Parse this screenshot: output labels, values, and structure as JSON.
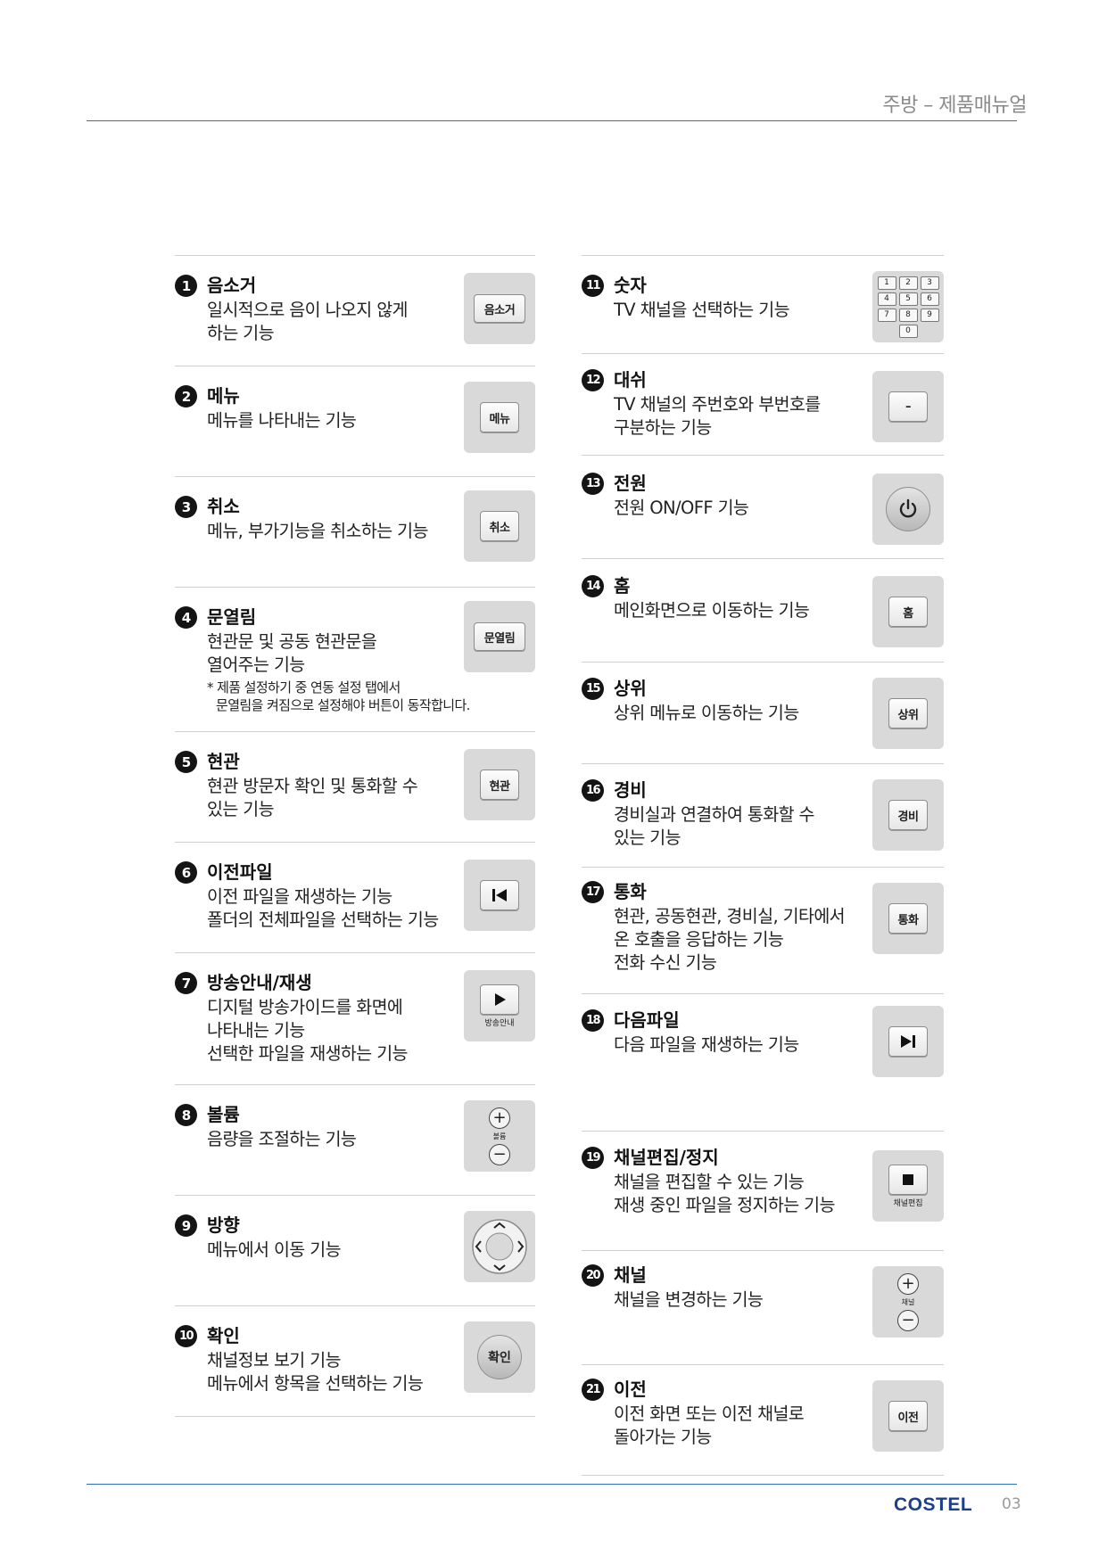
{
  "header": {
    "title": "주방 – 제품매뉴얼"
  },
  "footer": {
    "brand": "COSTEL",
    "page": "03"
  },
  "left_items": [
    {
      "num": "1",
      "title": "음소거",
      "desc": [
        "일시적으로 음이 나오지 않게",
        "하는 기능"
      ],
      "button": "음소거",
      "icon": "text-button"
    },
    {
      "num": "2",
      "title": "메뉴",
      "desc": [
        "메뉴를 나타내는 기능"
      ],
      "button": "메뉴",
      "icon": "text-button"
    },
    {
      "num": "3",
      "title": "취소",
      "desc": [
        "메뉴, 부가기능을 취소하는 기능"
      ],
      "button": "취소",
      "icon": "text-button"
    },
    {
      "num": "4",
      "title": "문열림",
      "desc": [
        "현관문 및 공동 현관문을",
        "열어주는 기능"
      ],
      "note": [
        "* 제품 설정하기 중 연동 설정 탭에서",
        "문열림을 켜짐으로 설정해야 버튼이 동작합니다."
      ],
      "button": "문열림",
      "icon": "text-button"
    },
    {
      "num": "5",
      "title": "현관",
      "desc": [
        "현관 방문자 확인 및 통화할 수",
        "있는 기능"
      ],
      "button": "현관",
      "icon": "text-button"
    },
    {
      "num": "6",
      "title": "이전파일",
      "desc": [
        "이전 파일을 재생하는 기능",
        "폴더의 전체파일을 선택하는 기능"
      ],
      "button": "",
      "icon": "prev-file-icon"
    },
    {
      "num": "7",
      "title": "방송안내/재생",
      "desc": [
        "디지털 방송가이드를 화면에",
        "나타내는 기능",
        "선택한 파일을 재생하는 기능"
      ],
      "button": "방송안내",
      "icon": "play-icon"
    },
    {
      "num": "8",
      "title": "볼륨",
      "desc": [
        "음량을 조절하는 기능"
      ],
      "button": "볼륨",
      "icon": "plus-minus-icon"
    },
    {
      "num": "9",
      "title": "방향",
      "desc": [
        "메뉴에서 이동 기능"
      ],
      "button": "",
      "icon": "direction-pad-icon"
    },
    {
      "num": "10",
      "title": "확인",
      "desc": [
        "채널정보 보기 기능",
        "메뉴에서 항목을 선택하는 기능"
      ],
      "button": "확인",
      "icon": "round-button"
    }
  ],
  "right_items": [
    {
      "num": "11",
      "title": "숫자",
      "desc": [
        "TV 채널을 선택하는 기능"
      ],
      "keys": [
        "1",
        "2",
        "3",
        "4",
        "5",
        "6",
        "7",
        "8",
        "9",
        "0"
      ],
      "icon": "keypad-icon"
    },
    {
      "num": "12",
      "title": "대쉬",
      "desc": [
        "TV 채널의 주번호와 부번호를",
        "구분하는 기능"
      ],
      "button": "–",
      "icon": "text-button"
    },
    {
      "num": "13",
      "title": "전원",
      "desc": [
        "전원 ON/OFF 기능"
      ],
      "button": "",
      "icon": "power-icon"
    },
    {
      "num": "14",
      "title": "홈",
      "desc": [
        "메인화면으로 이동하는 기능"
      ],
      "button": "홈",
      "icon": "text-button"
    },
    {
      "num": "15",
      "title": "상위",
      "desc": [
        "상위 메뉴로 이동하는 기능"
      ],
      "button": "상위",
      "icon": "text-button"
    },
    {
      "num": "16",
      "title": "경비",
      "desc": [
        "경비실과 연결하여 통화할 수",
        "있는 기능"
      ],
      "button": "경비",
      "icon": "text-button"
    },
    {
      "num": "17",
      "title": "통화",
      "desc": [
        "현관, 공동현관, 경비실, 기타에서",
        "온 호출을 응답하는 기능",
        "전화 수신 기능"
      ],
      "button": "통화",
      "icon": "text-button"
    },
    {
      "num": "18",
      "title": "다음파일",
      "desc": [
        "다음 파일을 재생하는 기능"
      ],
      "button": "",
      "icon": "next-file-icon"
    },
    {
      "num": "19",
      "title": "채널편집/정지",
      "desc": [
        "채널을 편집할 수 있는 기능",
        "재생 중인 파일을 정지하는 기능"
      ],
      "button": "채널편집",
      "icon": "stop-icon"
    },
    {
      "num": "20",
      "title": "채널",
      "desc": [
        "채널을 변경하는 기능"
      ],
      "button": "채널",
      "icon": "plus-minus-icon"
    },
    {
      "num": "21",
      "title": "이전",
      "desc": [
        "이전 화면 또는 이전 채널로",
        "돌아가는 기능"
      ],
      "button": "이전",
      "icon": "text-button"
    }
  ]
}
